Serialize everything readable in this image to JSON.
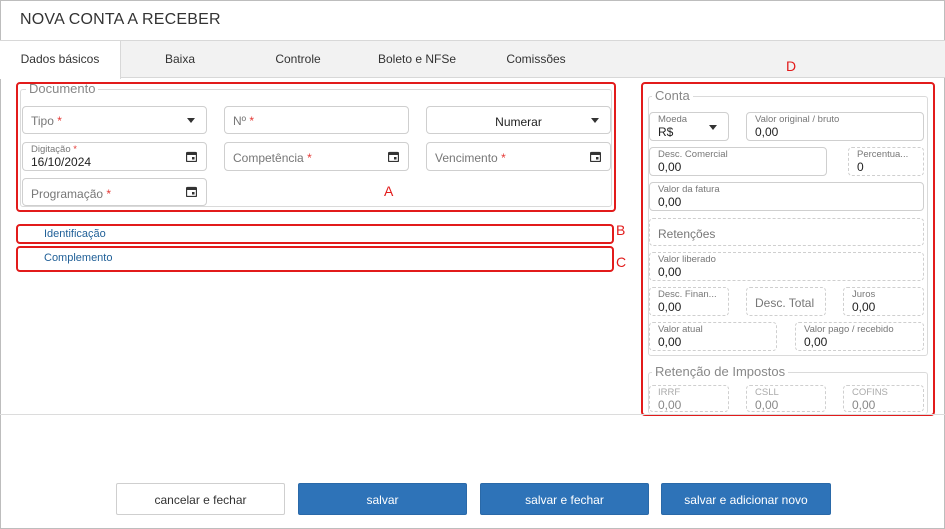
{
  "window": {
    "title": "NOVA CONTA A RECEBER"
  },
  "tabs": [
    {
      "label": "Dados básicos"
    },
    {
      "label": "Baixa"
    },
    {
      "label": "Controle"
    },
    {
      "label": "Boleto e NFSe"
    },
    {
      "label": "Comissões"
    }
  ],
  "documento": {
    "legend": "Documento",
    "tipo_placeholder": "Tipo",
    "numero_placeholder": "Nº",
    "numerar_value": "Numerar",
    "digitacao_label": "Digitação",
    "digitacao_value": "16/10/2024",
    "competencia_placeholder": "Competência",
    "vencimento_placeholder": "Vencimento",
    "programacao_placeholder": "Programação",
    "required_mark": "*"
  },
  "sections": {
    "identificacao": "Identificação",
    "complemento": "Complemento"
  },
  "conta": {
    "legend": "Conta",
    "moeda_label": "Moeda",
    "moeda_value": "R$",
    "valor_original_label": "Valor original / bruto",
    "valor_original_value": "0,00",
    "desc_comercial_label": "Desc. Comercial",
    "desc_comercial_value": "0,00",
    "percentual_label": "Percentua...",
    "percentual_value": "0",
    "valor_fatura_label": "Valor da fatura",
    "valor_fatura_value": "0,00",
    "retencoes_placeholder": "Retenções",
    "valor_liberado_label": "Valor liberado",
    "valor_liberado_value": "0,00",
    "desc_financ_label": "Desc. Finan...",
    "desc_financ_value": "0,00",
    "desc_total_placeholder": "Desc. Total",
    "juros_label": "Juros",
    "juros_value": "0,00",
    "valor_atual_label": "Valor atual",
    "valor_atual_value": "0,00",
    "valor_pago_label": "Valor pago / recebido",
    "valor_pago_value": "0,00"
  },
  "retencao": {
    "legend": "Retenção de Impostos",
    "irrf_label": "IRRF",
    "irrf_value": "0,00",
    "csll_label": "CSLL",
    "csll_value": "0,00",
    "cofins_label": "COFINS",
    "cofins_value": "0,00"
  },
  "annotations": {
    "a": "A",
    "b": "B",
    "c": "C",
    "d": "D"
  },
  "footer": {
    "cancel_label": "cancelar e fechar",
    "save_label": "salvar",
    "save_close_label": "salvar e fechar",
    "save_new_label": "salvar e adicionar novo"
  },
  "colors": {
    "primary": "#2e73b8",
    "annotation": "#e21b1b",
    "link": "#1f5f97",
    "required": "#e53935"
  }
}
